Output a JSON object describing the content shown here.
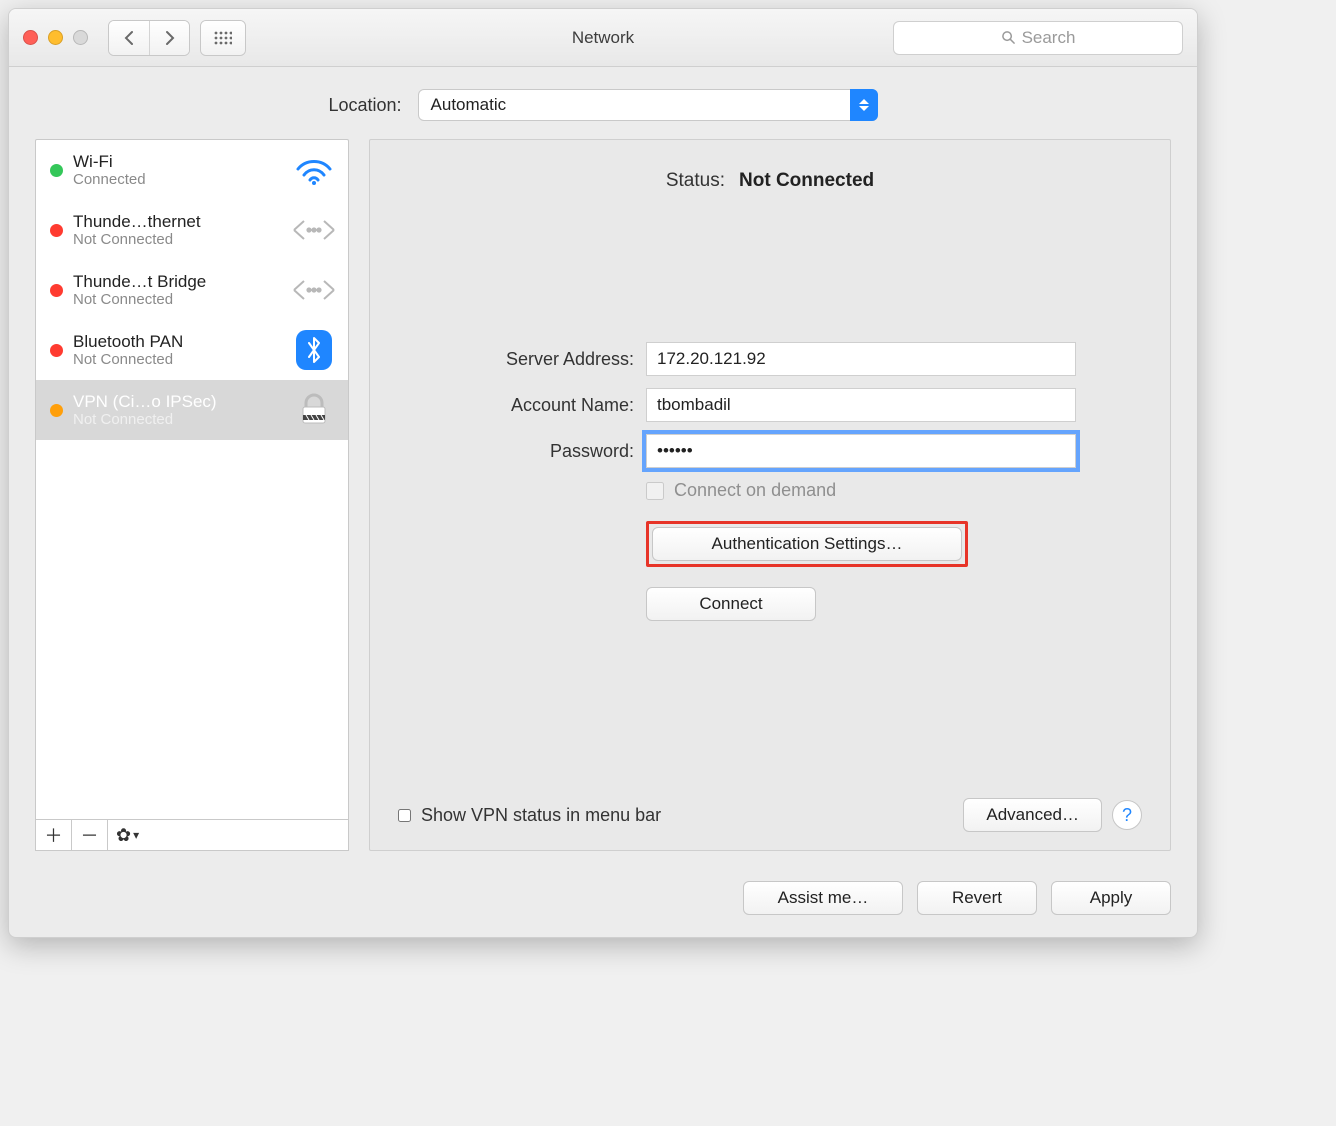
{
  "window": {
    "title": "Network"
  },
  "toolbar": {
    "search_placeholder": "Search"
  },
  "location": {
    "label": "Location:",
    "value": "Automatic"
  },
  "sidebar": {
    "items": [
      {
        "name": "Wi-Fi",
        "status": "Connected",
        "dot": "green",
        "icon": "wifi"
      },
      {
        "name": "Thunde…thernet",
        "status": "Not Connected",
        "dot": "red",
        "icon": "ether"
      },
      {
        "name": "Thunde…t Bridge",
        "status": "Not Connected",
        "dot": "red",
        "icon": "ether"
      },
      {
        "name": "Bluetooth PAN",
        "status": "Not Connected",
        "dot": "red",
        "icon": "bluetooth"
      },
      {
        "name": "VPN (Ci…o IPSec)",
        "status": "Not Connected",
        "dot": "orange",
        "icon": "lock",
        "selected": true
      }
    ]
  },
  "detail": {
    "status_label": "Status:",
    "status_value": "Not Connected",
    "server_label": "Server Address:",
    "server_value": "172.20.121.92",
    "account_label": "Account Name:",
    "account_value": "tbombadil",
    "password_label": "Password:",
    "password_value": "••••••",
    "connect_on_demand": "Connect on demand",
    "auth_button": "Authentication Settings…",
    "connect_button": "Connect",
    "show_vpn_status": "Show VPN status in menu bar",
    "advanced_button": "Advanced…"
  },
  "footer": {
    "assist": "Assist me…",
    "revert": "Revert",
    "apply": "Apply"
  }
}
